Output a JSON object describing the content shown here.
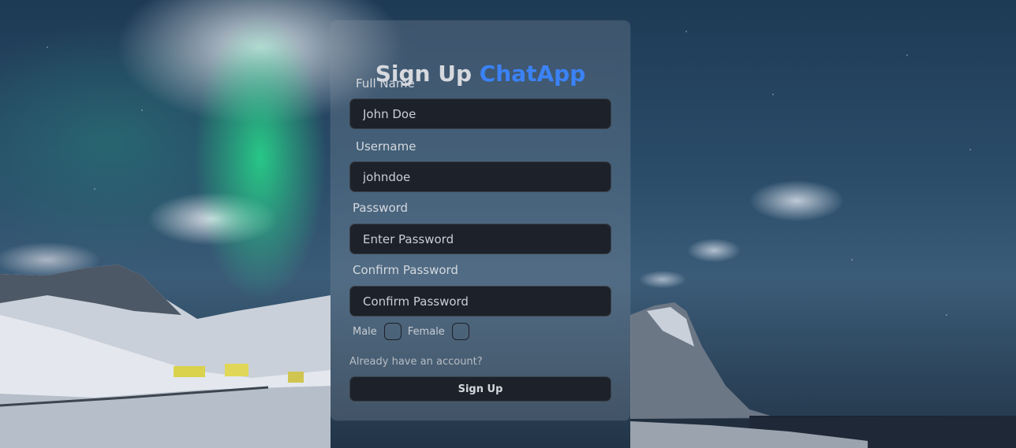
{
  "signup": {
    "title_prefix": "Sign Up",
    "title_brand": "ChatApp",
    "fields": {
      "full_name": {
        "label": "Full Name",
        "value": "John Doe",
        "placeholder": ""
      },
      "username": {
        "label": "Username",
        "value": "johndoe",
        "placeholder": ""
      },
      "password": {
        "label": "Password",
        "value": "",
        "placeholder": "Enter Password"
      },
      "confirm_password": {
        "label": "Confirm Password",
        "value": "",
        "placeholder": "Confirm Password"
      }
    },
    "gender": {
      "male_label": "Male",
      "female_label": "Female"
    },
    "login_link": "Already have an account?",
    "submit_label": "Sign Up"
  },
  "colors": {
    "brand": "#3b82f6",
    "input_bg": "#1d222a"
  }
}
